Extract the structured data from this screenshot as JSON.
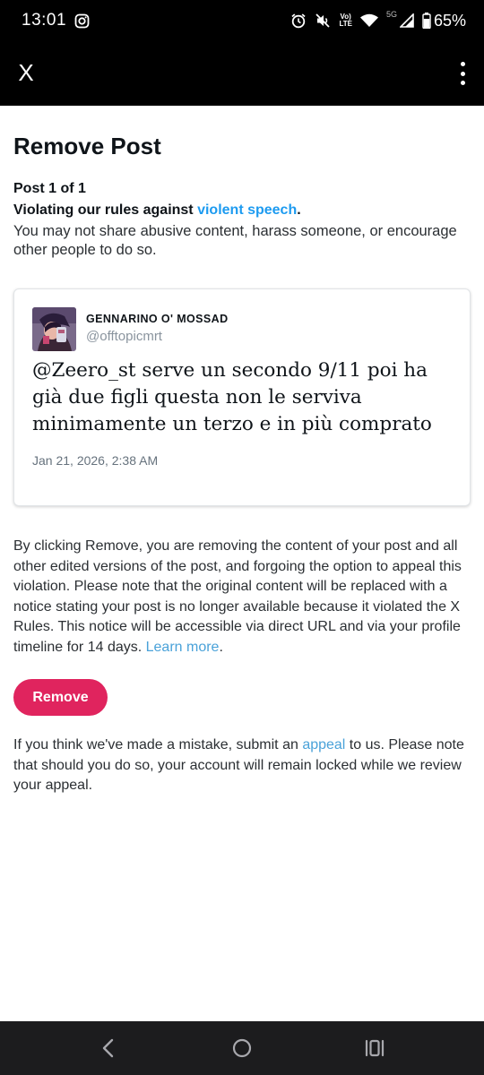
{
  "status_bar": {
    "time": "13:01",
    "network_label": "Vo) LTE",
    "network_line1": "Vo)",
    "network_line2": "LTE",
    "signal_type": "5G",
    "battery": "65%",
    "icons": [
      "instagram-icon",
      "alarm-icon",
      "mute-icon",
      "volte-icon",
      "wifi-icon",
      "signal-icon",
      "battery-icon"
    ]
  },
  "app_bar": {
    "close_label": "X",
    "menu_icon": "more-vert-icon"
  },
  "page": {
    "title": "Remove Post",
    "post_count": "Post 1 of 1",
    "violation_prefix": "Violating our rules against ",
    "violation_link": "violent speech",
    "violation_suffix": ".",
    "rule_description": "You may not share abusive content, harass someone, or encourage other people to do so."
  },
  "post": {
    "author_name": "GENNARINO O' MOSSAD",
    "author_handle": "@offtopicmrt",
    "text": "@Zeero_st serve un secondo 9/11 poi ha già due figli questa non le serviva minimamente un terzo e in più comprato",
    "date": "Jan 21, 2026, 2:38 AM"
  },
  "notice": {
    "text": "By clicking Remove, you are removing the content of your post and all other edited versions of the post, and forgoing the option to appeal this violation. Please note that the original content will be replaced with a notice stating your post is no longer available because it violated the X Rules. This notice will be accessible via direct URL and via your profile timeline for 14 days. ",
    "learn_more": "Learn more",
    "end": "."
  },
  "actions": {
    "remove_label": "Remove"
  },
  "appeal": {
    "prefix": "If you think we've made a mistake, submit an ",
    "link": "appeal",
    "suffix": " to us. Please note that should you do so, your account will remain locked while we review your appeal."
  },
  "colors": {
    "accent_link": "#1d9bf0",
    "remove_button": "#e0245e",
    "app_bar_bg": "#000000"
  }
}
